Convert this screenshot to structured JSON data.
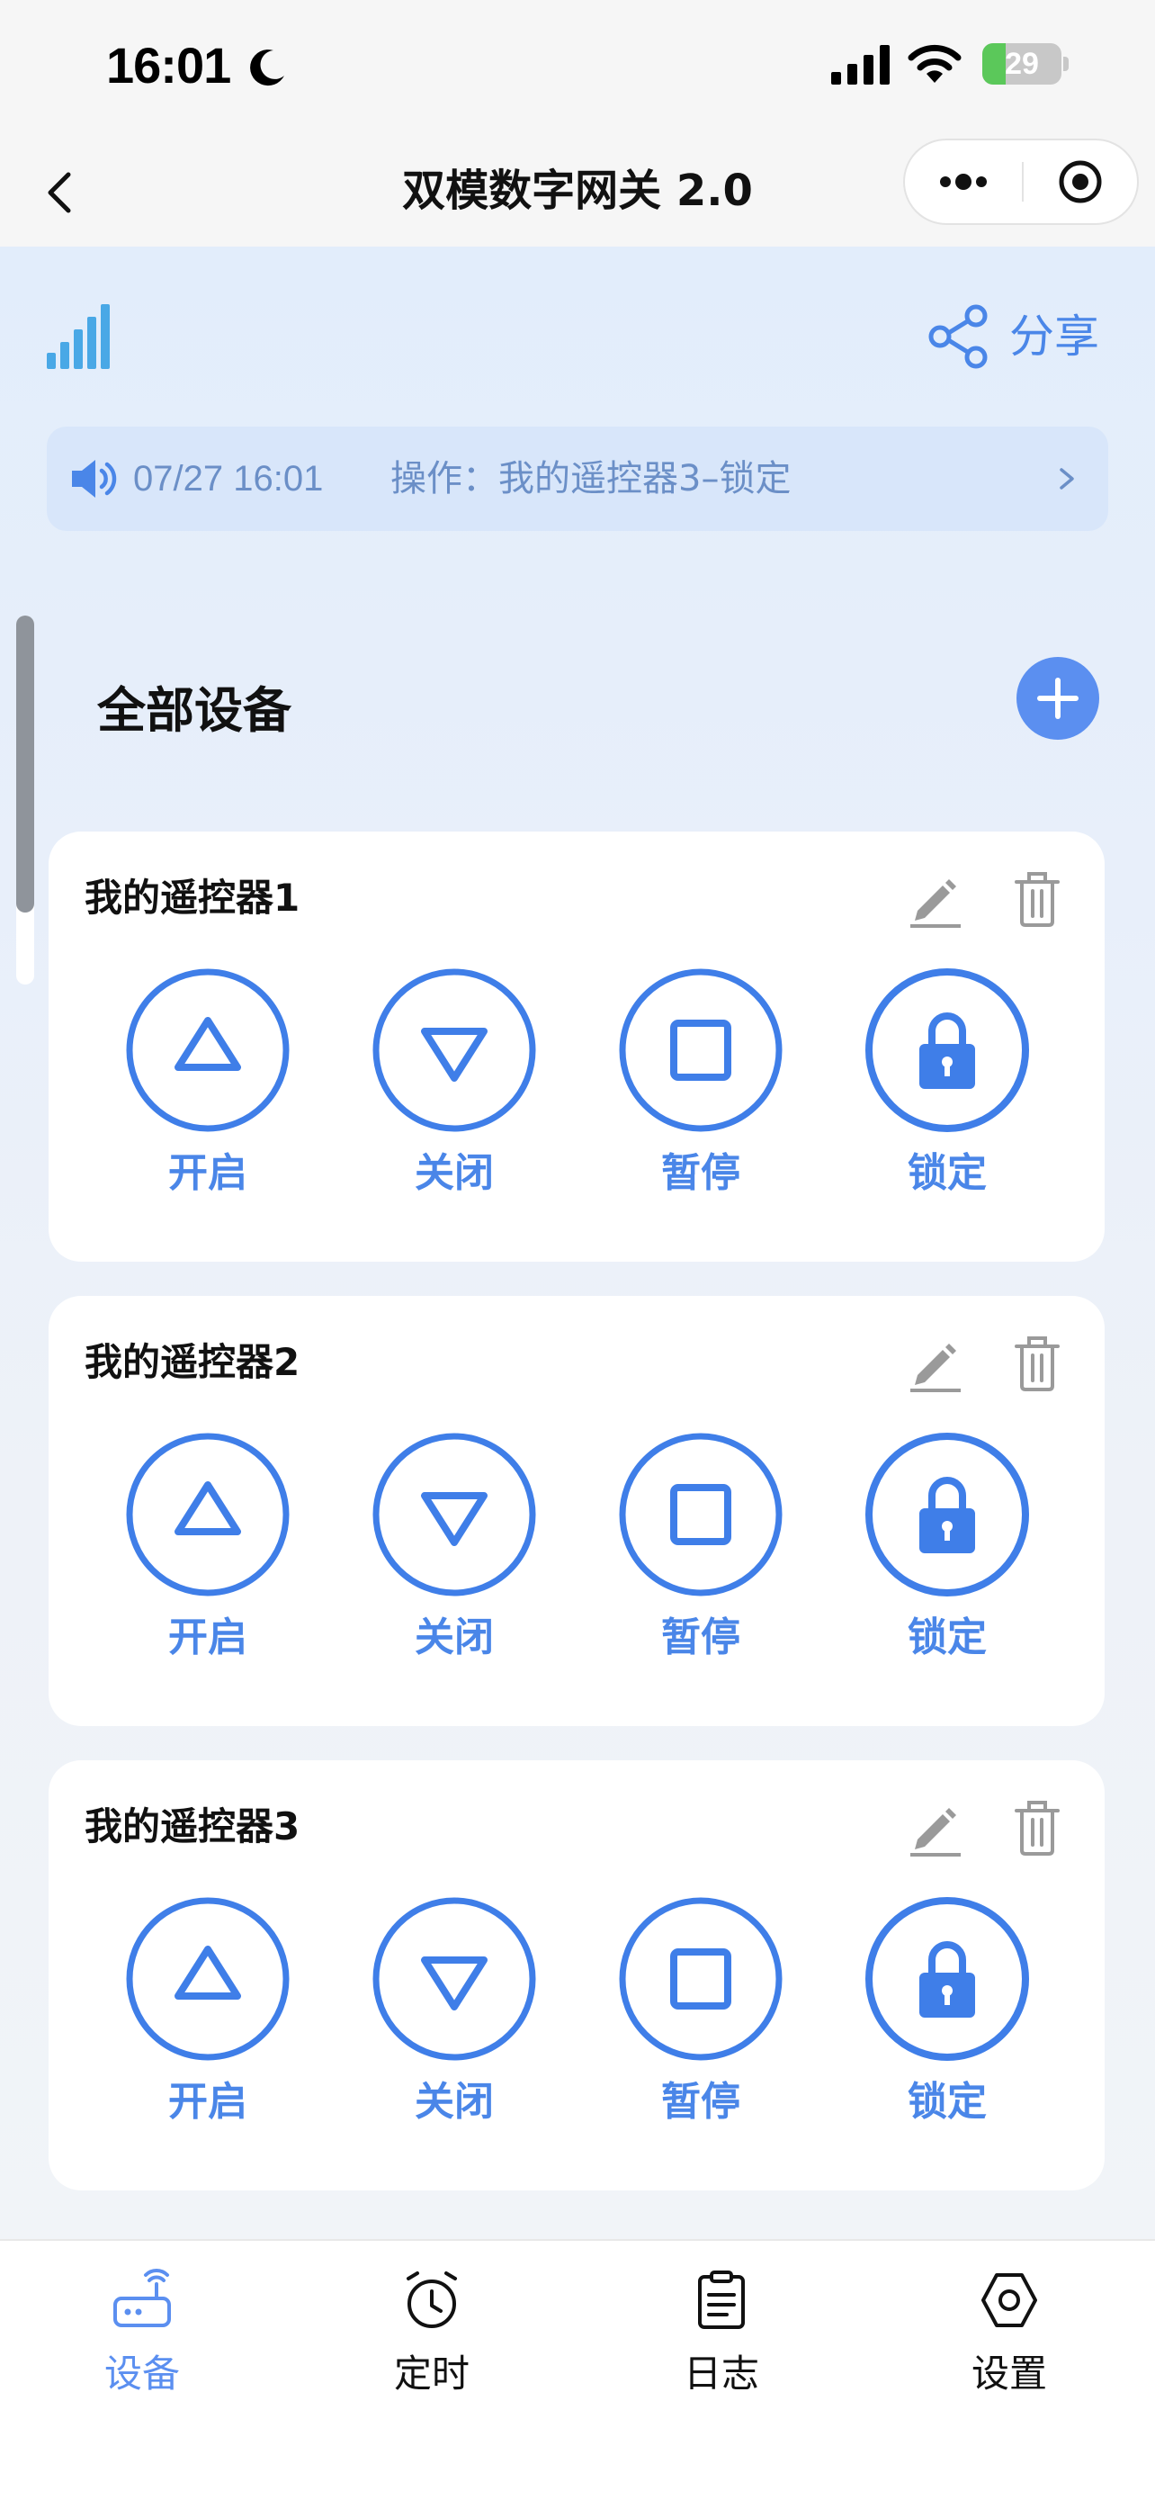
{
  "status_bar": {
    "time": "16:01",
    "battery": "29",
    "battery_level": 0.29
  },
  "nav": {
    "title": "双模数字网关 2.0"
  },
  "toolbar": {
    "share_label": "分享"
  },
  "notice": {
    "time": "07/27 16:01",
    "text": "操作：我的遥控器3–锁定"
  },
  "section": {
    "title": "全部设备"
  },
  "devices": [
    {
      "name": "我的遥控器1",
      "controls": [
        "开启",
        "关闭",
        "暂停",
        "锁定"
      ]
    },
    {
      "name": "我的遥控器2",
      "controls": [
        "开启",
        "关闭",
        "暂停",
        "锁定"
      ]
    },
    {
      "name": "我的遥控器3",
      "controls": [
        "开启",
        "关闭",
        "暂停",
        "锁定"
      ]
    }
  ],
  "tabs": [
    {
      "label": "设备",
      "icon": "router-icon",
      "active": true
    },
    {
      "label": "定时",
      "icon": "alarm-clock-icon",
      "active": false
    },
    {
      "label": "日志",
      "icon": "clipboard-icon",
      "active": false
    },
    {
      "label": "设置",
      "icon": "hexagon-settings-icon",
      "active": false
    }
  ],
  "colors": {
    "accent": "#4a86e8",
    "tab_active": "#5b8ff0",
    "notice_bg": "#d8e6fa"
  }
}
